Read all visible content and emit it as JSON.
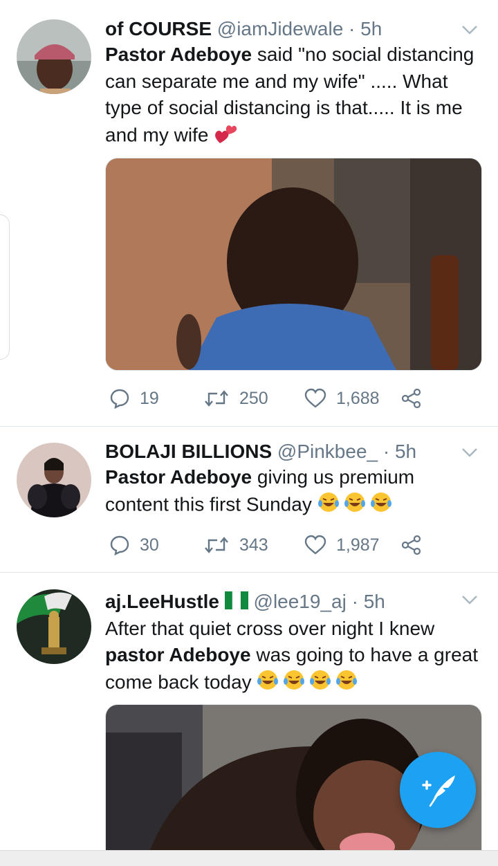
{
  "tweets": [
    {
      "name": "of COURSE",
      "handle": "@iamJidewale · 5h",
      "text_bold": "Pastor Adeboye",
      "text_rest": " said \"no social distancing can separate me and my wife\" ..... What type of social distancing is that..... It is me and my wife",
      "emoji": "two-hearts",
      "replies": "19",
      "retweets": "250",
      "likes": "1,688"
    },
    {
      "name": "BOLAJI BILLIONS",
      "handle": "@Pinkbee_ · 5h",
      "text_bold": "Pastor Adeboye",
      "text_rest": " giving us premium content this first Sunday",
      "emoji": "laughing-tears x3",
      "replies": "30",
      "retweets": "343",
      "likes": "1,987"
    },
    {
      "name": "aj.LeeHustle",
      "handle": "@lee19_aj · 5h",
      "text_pre": "After that quiet cross over night I knew ",
      "text_bold": "pastor Adeboye",
      "text_rest": " was going to have a great come back today",
      "emoji": "laughing-tears x4"
    }
  ],
  "colors": {
    "accent": "#1da1f2",
    "text": "#14171a",
    "secondary": "#657786",
    "divider": "#e1e8ed"
  }
}
